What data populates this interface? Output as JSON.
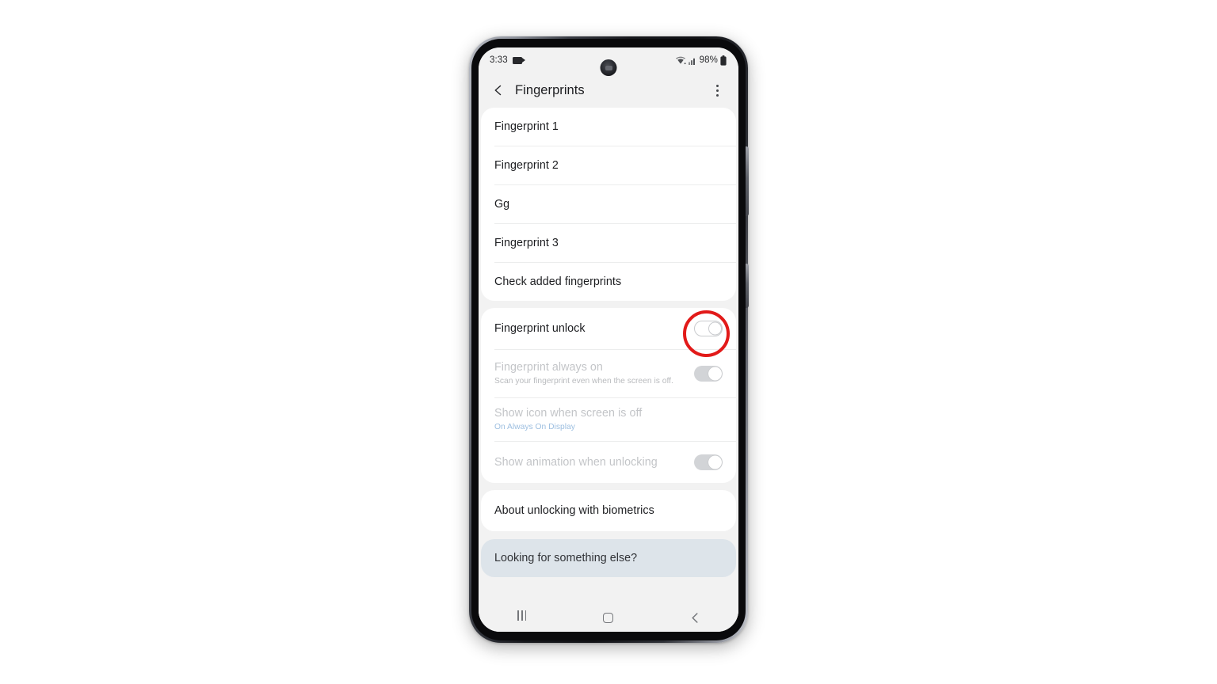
{
  "status_bar": {
    "time": "3:33",
    "screen_record_icon": "video-camera-icon",
    "wifi_icon": "wifi-icon",
    "signal_icon": "cellular-signal-icon",
    "battery_percent": "98%",
    "battery_icon": "battery-full-icon"
  },
  "app_bar": {
    "back_icon": "back-chevron-icon",
    "title": "Fingerprints",
    "overflow_icon": "more-vertical-icon"
  },
  "sections": [
    {
      "name": "fingerprint-list",
      "rows": [
        {
          "title": "Fingerprint 1"
        },
        {
          "title": "Fingerprint 2"
        },
        {
          "title": "Gg"
        },
        {
          "title": "Fingerprint 3"
        },
        {
          "title": "Check added fingerprints"
        }
      ]
    },
    {
      "name": "fingerprint-options",
      "rows": [
        {
          "title": "Fingerprint unlock",
          "toggle": "off",
          "disabled": false,
          "highlighted": true
        },
        {
          "title": "Fingerprint always on",
          "subtitle": "Scan your fingerprint even when the screen is off.",
          "toggle": "on-disabled",
          "disabled": true
        },
        {
          "title": "Show icon when screen is off",
          "subtitle": "On Always On Display",
          "subtitle_style": "blue",
          "disabled": true
        },
        {
          "title": "Show animation when unlocking",
          "toggle": "on-disabled",
          "disabled": true
        }
      ]
    },
    {
      "name": "about-section",
      "rows": [
        {
          "title": "About unlocking with biometrics"
        }
      ]
    }
  ],
  "footer": {
    "title": "Looking for something else?"
  },
  "nav_bar": {
    "recents_icon": "recent-apps-icon",
    "home_icon": "home-square-icon",
    "back_icon": "back-chevron-icon"
  },
  "annotation": {
    "shape": "circle",
    "color": "#e21a19",
    "target": "fingerprint-unlock-toggle"
  },
  "colors": {
    "screen_background": "#f2f2f2",
    "card_background": "#ffffff",
    "footer_background": "#dde4ea",
    "primary_text": "#1c1d20",
    "disabled_text": "#c3c5c8",
    "subtitle_blue": "#9dbfe0",
    "annotation_red": "#e21a19"
  }
}
